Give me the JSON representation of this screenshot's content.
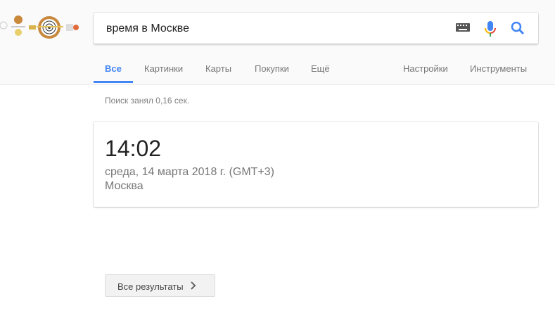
{
  "search": {
    "query": "время в Москве"
  },
  "tabs": [
    {
      "label": "Все"
    },
    {
      "label": "Картинки"
    },
    {
      "label": "Карты"
    },
    {
      "label": "Покупки"
    },
    {
      "label": "Ещё"
    }
  ],
  "tools": {
    "settings": "Настройки",
    "tools": "Инструменты"
  },
  "stats": "Поиск занял 0,16 сек.",
  "card": {
    "time": "14:02",
    "date": "среда, 14 марта 2018 г. (GMT+3)",
    "city": "Москва"
  },
  "more_button": "Все результаты",
  "colors": {
    "accent": "#4285f4"
  }
}
